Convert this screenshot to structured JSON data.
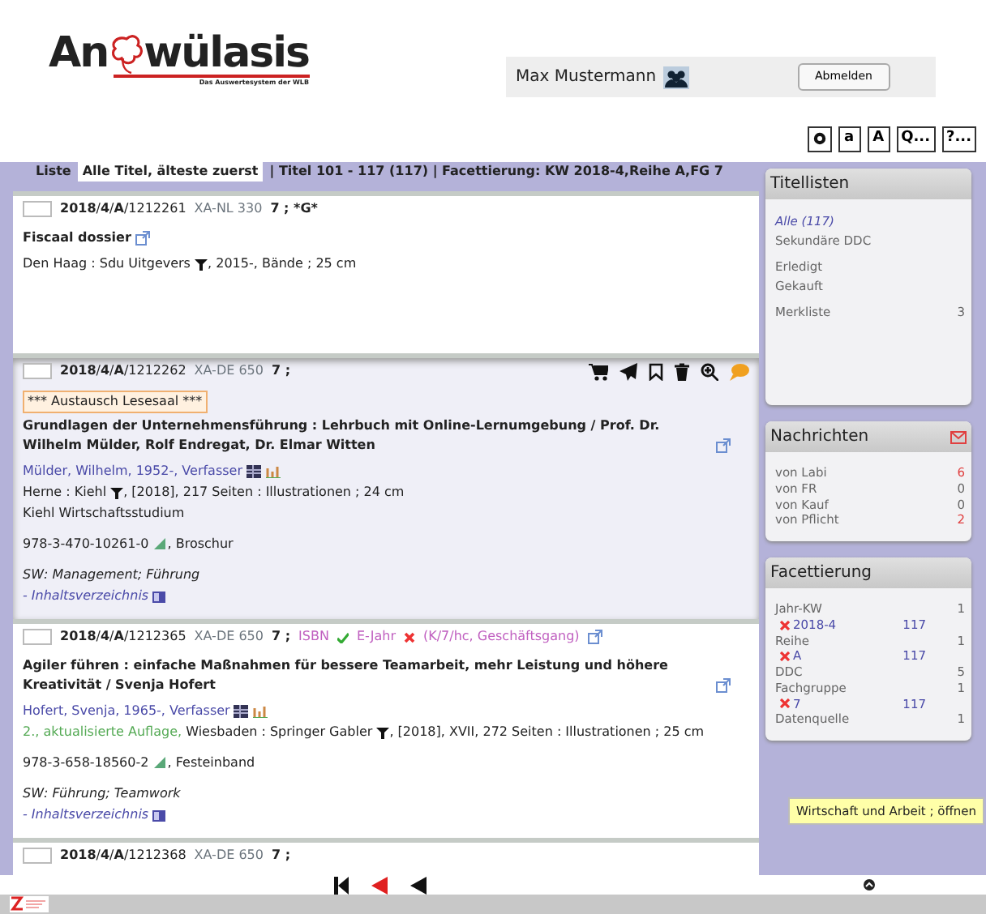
{
  "header": {
    "logo": {
      "left": "An",
      "right": "wülasis",
      "tagline": "Das Auswertesystem der WLB"
    },
    "user": "Max Mustermann",
    "logout": "Abmelden"
  },
  "toolbar": [
    {
      "kind": "icon"
    },
    {
      "kind": "text",
      "label": "a"
    },
    {
      "kind": "text",
      "label": "A"
    },
    {
      "kind": "text",
      "label": "Q..."
    },
    {
      "kind": "text",
      "label": "?..."
    }
  ],
  "list_header": {
    "prefix": "Liste",
    "sort": "Alle Titel, älteste zuerst",
    "info": "| Titel 101 - 117 (117) | Facettierung: KW 2018-4,Reihe A,FG 7"
  },
  "records": [
    {
      "highlighted": false,
      "checked": false,
      "call": "**2018**/**4**/**A**/1212261",
      "notation": "XA-NL 330",
      "tail": "7 ; *G*",
      "lines": [
        {
          "kind": "title",
          "text": "Fiscaal dossier"
        },
        {
          "kind": "imprint",
          "publisher": "Den Haag : Sdu Uitgevers",
          "rest": ", 2015-, Bände ; 25 cm"
        }
      ]
    },
    {
      "highlighted": true,
      "checked": false,
      "call": "**2018**/**4**/**A**/1212262",
      "notation": "XA-DE 650",
      "tail": "7 ;",
      "lines": [
        {
          "kind": "notice",
          "text": "*** Austausch Lesesaal ***"
        },
        {
          "kind": "title",
          "text": "Grundlagen der Unternehmensführung : Lehrbuch mit Online-Lernumgebung / Prof. Dr. Wilhelm Mülder, Rolf Endregat, Dr. Elmar Witten"
        },
        {
          "kind": "author",
          "text": "Mülder, Wilhelm, 1952-, Verfasser"
        },
        {
          "kind": "imprint",
          "publisher": "Herne : Kiehl",
          "rest": ", [2018], 217 Seiten : Illustrationen ; 24 cm"
        },
        {
          "kind": "series",
          "text": "Kiehl Wirtschaftsstudium"
        },
        {
          "kind": "isbn",
          "isbn": "978-3-470-10261-0",
          "binding": ", Broschur"
        },
        {
          "kind": "subjects",
          "text": "SW: Management; Führung"
        },
        {
          "kind": "toc",
          "text": "- Inhaltsverzeichnis"
        }
      ]
    },
    {
      "highlighted": false,
      "checked": false,
      "call": "**2018**/**4**/**A**/1212365",
      "notation": "XA-DE 650",
      "tail": "7 ;",
      "checks": [
        {
          "label": "ISBN",
          "ok": true
        },
        {
          "label": "E-Jahr",
          "ok": false
        }
      ],
      "status_note": "(K/7/hc, Geschäftsgang)",
      "lines": [
        {
          "kind": "title",
          "text": "Agiler führen : einfache Maßnahmen für bessere Teamarbeit, mehr Leistung und höhere Kreativität / Svenja Hofert"
        },
        {
          "kind": "author",
          "text": "Hofert, Svenja, 1965-, Verfasser"
        },
        {
          "kind": "imprint",
          "edition": "2., aktualisierte Auflage,",
          "publisher": "Wiesbaden : Springer Gabler",
          "rest": ", [2018], XVII, 272 Seiten : Illustrationen ; 25 cm"
        },
        {
          "kind": "isbn",
          "isbn": "978-3-658-18560-2",
          "binding": ", Festeinband"
        },
        {
          "kind": "subjects",
          "text": "SW: Führung; Teamwork"
        },
        {
          "kind": "toc",
          "text": "- Inhaltsverzeichnis"
        }
      ]
    },
    {
      "highlighted": false,
      "checked": false,
      "call": "**2018**/**4**/**A**/1212368",
      "notation": "XA-DE 650",
      "tail": "7 ;"
    }
  ],
  "sidebar": {
    "title_lists": {
      "title": "Titellisten",
      "groups": [
        [
          {
            "label": "Alle (117)",
            "selected": true
          },
          {
            "label": "Sekundäre DDC",
            "selected": false
          }
        ],
        [
          {
            "label": "Erledigt",
            "selected": false
          },
          {
            "label": "Gekauft",
            "selected": false
          }
        ],
        [
          {
            "label": "Merkliste",
            "count": "3",
            "selected": false
          }
        ]
      ]
    },
    "messages": {
      "title": "Nachrichten",
      "items": [
        {
          "label": "von Labi",
          "count": "6",
          "unread": true
        },
        {
          "label": "von FR",
          "count": "0",
          "unread": false
        },
        {
          "label": "von Kauf",
          "count": "0",
          "unread": false
        },
        {
          "label": "von Pflicht",
          "count": "2",
          "unread": true
        }
      ]
    },
    "facets": {
      "title": "Facettierung",
      "items": [
        {
          "kind": "facet",
          "label": "Jahr-KW",
          "count": "1"
        },
        {
          "kind": "filter",
          "label": "2018-4",
          "count": "117"
        },
        {
          "kind": "facet",
          "label": "Reihe",
          "count": "1"
        },
        {
          "kind": "filter",
          "label": "A",
          "count": "117"
        },
        {
          "kind": "facet",
          "label": "DDC",
          "count": "5"
        },
        {
          "kind": "facet",
          "label": "Fachgruppe",
          "count": "1"
        },
        {
          "kind": "filter",
          "label": "7",
          "count": "117"
        },
        {
          "kind": "facet",
          "label": "Datenquelle",
          "count": "1"
        }
      ],
      "tooltip": "Wirtschaft und Arbeit ; öffnen"
    }
  }
}
